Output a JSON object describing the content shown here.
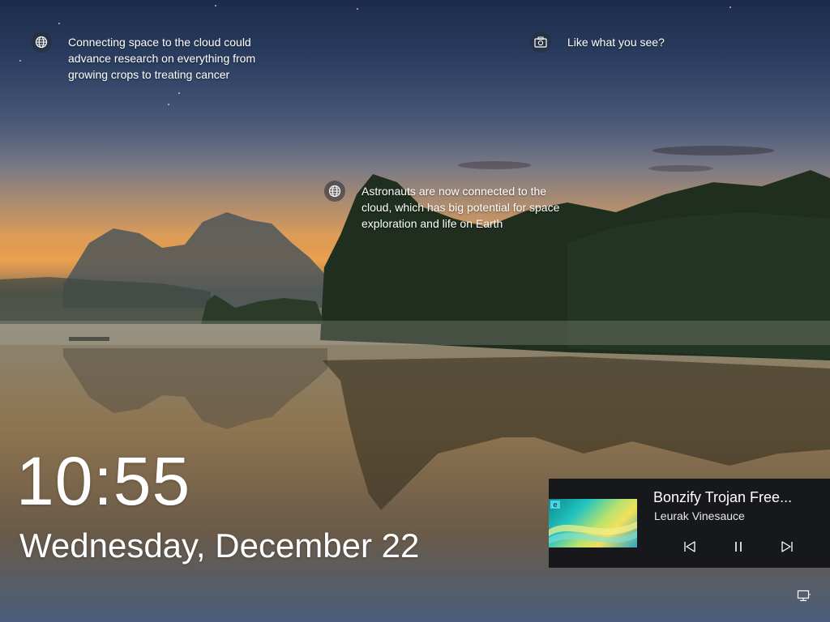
{
  "spotlight": {
    "tip_top_left": "Connecting space to the cloud could\nadvance research on everything from\ngrowing crops to treating cancer",
    "tip_top_right": "Like what you see?",
    "tip_center": "Astronauts are now connected to the\ncloud, which has big potential for space\nexploration and life on Earth",
    "icons": {
      "tip_top_left": "globe-icon",
      "tip_top_right": "camera-icon",
      "tip_center": "globe-icon"
    }
  },
  "clock": {
    "time": "10:55",
    "date": "Wednesday, December 22"
  },
  "media": {
    "title": "Bonzify Trojan Free...",
    "artist": "Leurak Vinesauce",
    "controls": [
      "previous-track",
      "pause",
      "next-track"
    ]
  },
  "system": {
    "corner_icon": "network-icon"
  },
  "colors": {
    "text": "#ffffff",
    "media_bg": "#16181b"
  }
}
